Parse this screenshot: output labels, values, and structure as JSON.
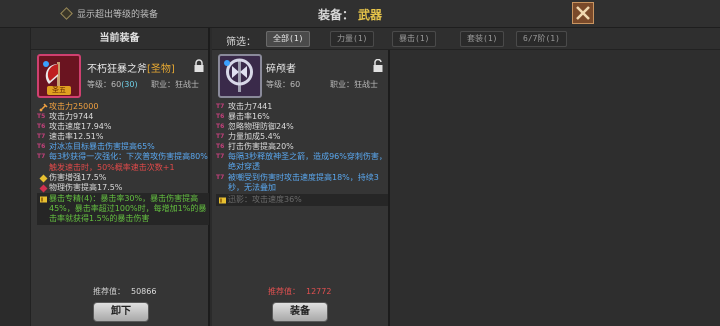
{
  "top": {
    "toggle_label": "显示超出等级的装备",
    "title": "装备：",
    "title_type": "武器"
  },
  "current": {
    "header": "当前装备",
    "name": "不朽狂暴之斧",
    "tag": "[圣物]",
    "badge": "圣五",
    "level_label": "等级：60",
    "level_extra": "(30)",
    "job": "职业：狂战士",
    "stats": [
      {
        "tier": "",
        "icon": "sword",
        "text": "攻击力25000",
        "color": "orange"
      },
      {
        "tier": "T5",
        "text": "攻击力9744",
        "color": "white"
      },
      {
        "tier": "T6",
        "text": "攻击速度17.94%",
        "color": "white"
      },
      {
        "tier": "T7",
        "text": "速击率12.51%",
        "color": "white"
      },
      {
        "tier": "T6",
        "text": "对冰冻目标暴击伤害提高65%",
        "color": "blue"
      },
      {
        "tier": "T7",
        "text": "每3秒获得一次强化：下次普攻伤害提高80%",
        "color": "blue",
        "multi": true
      },
      {
        "tier": "",
        "text": "触发速击时，50%概率速击次数+1",
        "color": "red"
      },
      {
        "tier": "",
        "icon": "gem-yellow",
        "text": "伤害增强17.5%",
        "color": "white"
      },
      {
        "tier": "",
        "icon": "gem-red",
        "text": "物理伤害提高17.5%",
        "color": "white"
      },
      {
        "tier": "",
        "icon": "book",
        "text": "暴击专精(4)：暴击率30%，暴击伤害提高45%，暴击率超过100%时，每增加1%的暴击率就获得1.5%的暴击伤害",
        "color": "green",
        "multi": true
      }
    ],
    "score_label": "推荐值：",
    "score": "50866",
    "button": "卸下"
  },
  "filter": {
    "label": "筛选：",
    "tabs": [
      "全部(1)",
      "力量(1)",
      "暴击(1)",
      "套装(1)",
      "6/7阶(1)"
    ]
  },
  "candidate": {
    "name": "碎颅者",
    "level_label": "等级：60",
    "job": "职业：狂战士",
    "stats": [
      {
        "tier": "T7",
        "text": "攻击力7441",
        "color": "white"
      },
      {
        "tier": "T6",
        "text": "暴击率16%",
        "color": "white"
      },
      {
        "tier": "T6",
        "text": "忽略物理防御24%",
        "color": "white"
      },
      {
        "tier": "T7",
        "text": "力量加成5.4%",
        "color": "white"
      },
      {
        "tier": "T6",
        "text": "打击伤害提高20%",
        "color": "white"
      },
      {
        "tier": "T7",
        "text": "每隔3秒释放神圣之箭，造成96%穿刺伤害，绝对穿透",
        "color": "blue",
        "multi": true
      },
      {
        "tier": "T7",
        "text": "被嘲受到伤害时攻击速度提高18%，持续3秒，无法叠加",
        "color": "blue",
        "multi": true
      },
      {
        "tier": "",
        "icon": "book",
        "text": "迅影：攻击速度36%",
        "color": "gray"
      }
    ],
    "score_label": "推荐值：",
    "score": "12772",
    "button": "装备"
  },
  "colors": {
    "orange": "#f0a040",
    "white": "#dcdcdc",
    "blue": "#5aa8f0",
    "red": "#e04a4a",
    "green": "#64c040",
    "gray": "#6a6a6a"
  }
}
